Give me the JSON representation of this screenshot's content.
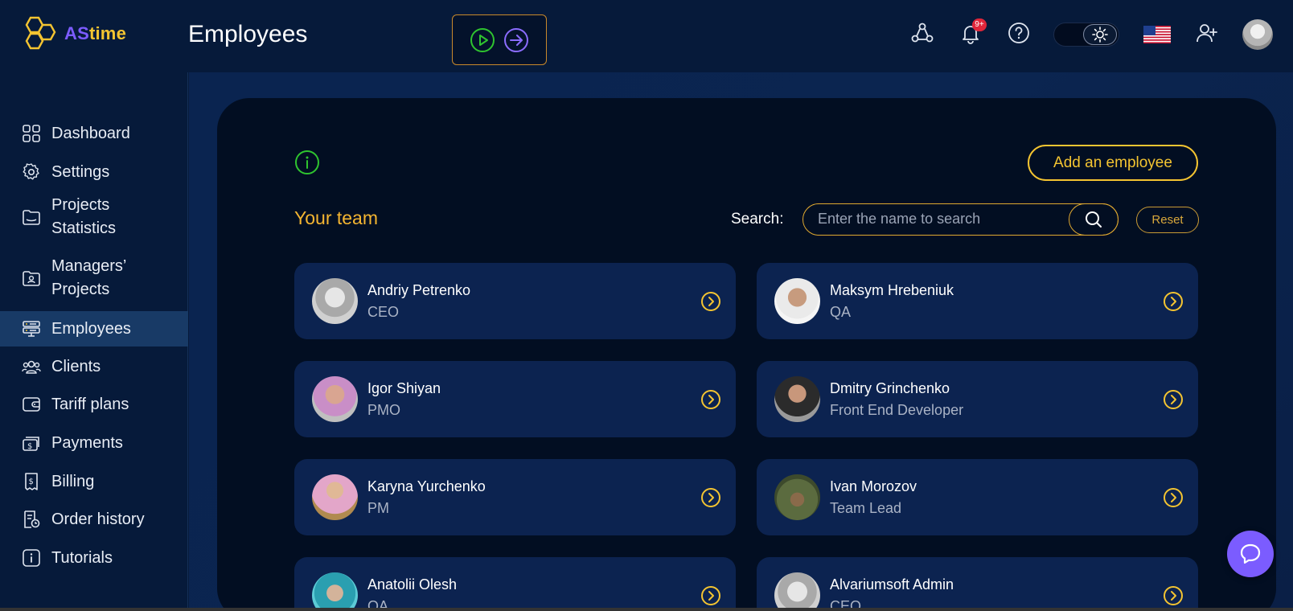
{
  "app": {
    "logo_as": "AS",
    "logo_time": "time",
    "page_title": "Employees"
  },
  "header": {
    "notification_count": "9+",
    "icons": [
      "share-network-icon",
      "bell-icon",
      "help-icon",
      "sun-icon",
      "us-flag-icon",
      "add-user-icon",
      "user-avatar"
    ]
  },
  "sidebar": {
    "items": [
      {
        "label": "Dashboard",
        "icon": "dashboard-icon"
      },
      {
        "label": "Settings",
        "icon": "gear-icon"
      },
      {
        "label": "Projects Statistics",
        "icon": "folder-icon"
      },
      {
        "label": "Managers’ Projects",
        "icon": "manager-folder-icon"
      },
      {
        "label": "Employees",
        "icon": "employees-icon",
        "active": true
      },
      {
        "label": "Clients",
        "icon": "clients-icon"
      },
      {
        "label": "Tariff plans",
        "icon": "wallet-icon"
      },
      {
        "label": "Payments",
        "icon": "payments-icon"
      },
      {
        "label": "Billing",
        "icon": "billing-icon"
      },
      {
        "label": "Order history",
        "icon": "order-history-icon"
      },
      {
        "label": "Tutorials",
        "icon": "info-icon"
      }
    ]
  },
  "main": {
    "add_button": "Add an employee",
    "team_title": "Your team",
    "search_label": "Search:",
    "search_placeholder": "Enter the name to search",
    "reset_button": "Reset",
    "employees": [
      {
        "name": "Andriy Petrenko",
        "role": "CEO"
      },
      {
        "name": "Maksym Hrebeniuk",
        "role": "QA"
      },
      {
        "name": "Igor Shiyan",
        "role": "PMO"
      },
      {
        "name": "Dmitry Grinchenko",
        "role": "Front End Developer"
      },
      {
        "name": "Karyna Yurchenko",
        "role": "PM"
      },
      {
        "name": "Ivan Morozov",
        "role": "Team Lead"
      },
      {
        "name": "Anatolii Olesh",
        "role": "QA"
      },
      {
        "name": "Alvariumsoft Admin",
        "role": "CEO"
      }
    ]
  },
  "colors": {
    "accent_yellow": "#f4c431",
    "accent_purple": "#7b5cff",
    "background": "#061a3a",
    "panel": "#020e22",
    "card": "#0c2350"
  }
}
